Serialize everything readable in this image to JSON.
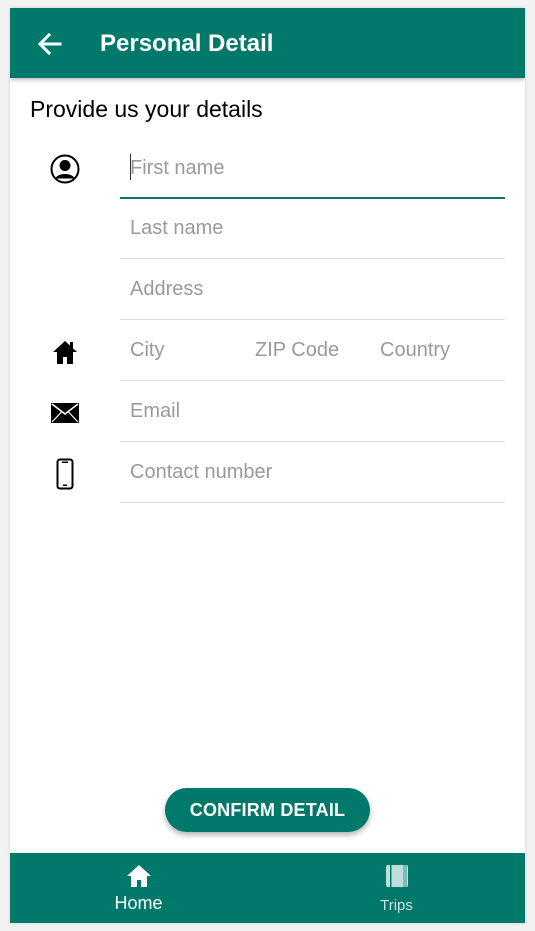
{
  "header": {
    "title": "Personal Detail",
    "back_icon": "arrow-left-icon",
    "color": "#00796b"
  },
  "form": {
    "heading": "Provide us your details",
    "fields": {
      "first_name": {
        "placeholder": "First name",
        "value": ""
      },
      "last_name": {
        "placeholder": "Last name",
        "value": ""
      },
      "address": {
        "placeholder": "Address",
        "value": ""
      },
      "city": {
        "placeholder": "City",
        "value": ""
      },
      "zip": {
        "placeholder": "ZIP Code",
        "value": ""
      },
      "country": {
        "placeholder": "Country",
        "value": ""
      },
      "email": {
        "placeholder": "Email",
        "value": ""
      },
      "contact": {
        "placeholder": "Contact number",
        "value": ""
      }
    },
    "icons": [
      "person-icon",
      "home-icon",
      "mail-icon",
      "phone-icon"
    ],
    "accent_color": "#00796b"
  },
  "actions": {
    "confirm_label": "CONFIRM DETAIL"
  },
  "bottom_nav": {
    "items": [
      {
        "label": "Home",
        "icon": "home-icon",
        "active": true
      },
      {
        "label": "Trips",
        "icon": "book-icon",
        "active": false
      }
    ]
  }
}
